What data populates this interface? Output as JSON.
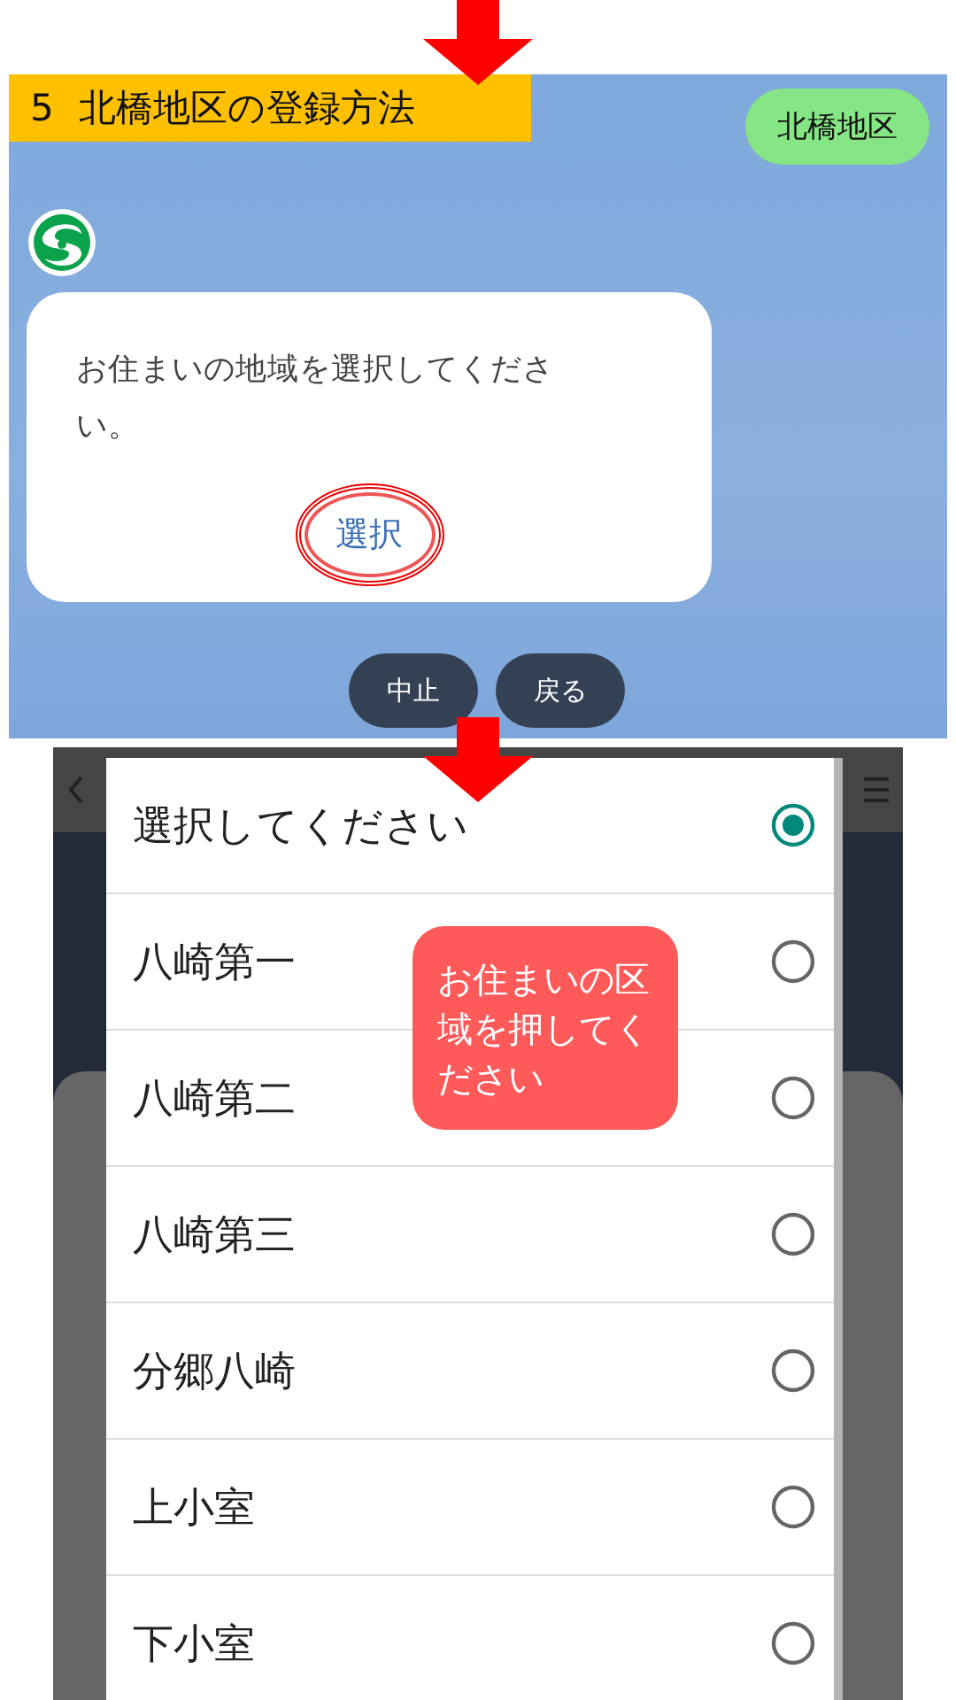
{
  "header": {
    "step": "5",
    "title": "北橋地区の登録方法"
  },
  "chat": {
    "user_message": "北橋地区",
    "bot_message": "お住まいの地域を選択してください。",
    "select_button": "選択",
    "quick_replies": [
      "中止",
      "戻る"
    ]
  },
  "picker": {
    "options": [
      {
        "label": "選択してください",
        "selected": true
      },
      {
        "label": "八崎第一",
        "selected": false
      },
      {
        "label": "八崎第二",
        "selected": false
      },
      {
        "label": "八崎第三",
        "selected": false
      },
      {
        "label": "分郷八崎",
        "selected": false
      },
      {
        "label": "上小室",
        "selected": false
      },
      {
        "label": "下小室",
        "selected": false
      }
    ]
  },
  "callout": "お住まいの区域を押してください"
}
